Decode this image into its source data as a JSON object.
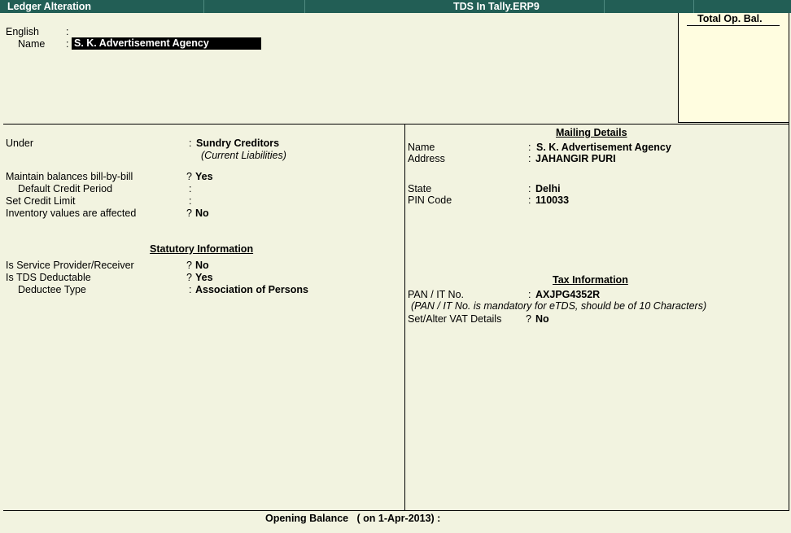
{
  "titlebar": {
    "left": "Ledger Alteration",
    "center": "TDS In Tally.ERP9"
  },
  "header": {
    "english_label": "English",
    "name_label": "Name",
    "colon": ":",
    "name_value": "S. K. Advertisement Agency",
    "total_op_bal_label": "Total Op. Bal."
  },
  "left": {
    "under_label": "Under",
    "under_value": "Sundry Creditors",
    "under_group": "(Current Liabilities)",
    "bill_by_bill_label": "Maintain balances bill-by-bill",
    "bill_by_bill_value": "Yes",
    "credit_period_label": "Default Credit Period",
    "credit_limit_label": "Set Credit Limit",
    "inventory_label": "Inventory values are affected",
    "inventory_value": "No",
    "statutory_heading": "Statutory Information",
    "service_label": "Is Service Provider/Receiver",
    "service_value": "No",
    "tds_label": "Is TDS Deductable",
    "tds_value": "Yes",
    "deductee_label": "Deductee Type",
    "deductee_value": "Association of Persons"
  },
  "right": {
    "mailing_heading": "Mailing Details",
    "name_label": "Name",
    "name_value": "S. K. Advertisement Agency",
    "address_label": "Address",
    "address_value": "JAHANGIR PURI",
    "state_label": "State",
    "state_value": "Delhi",
    "pin_label": "PIN Code",
    "pin_value": "110033",
    "tax_heading": "Tax Information",
    "pan_label": "PAN / IT No.",
    "pan_value": "AXJPG4352R",
    "pan_note": "(PAN / IT No. is mandatory for eTDS, should be of 10 Characters)",
    "vat_label": "Set/Alter VAT Details",
    "vat_value": "No"
  },
  "footer": {
    "opening_balance": "Opening Balance   ( on 1-Apr-2013) :"
  },
  "symbols": {
    "colon": ":",
    "question": "?"
  },
  "colors": {
    "titlebar": "#225e55",
    "background": "#f2f3e0",
    "opbal_box": "#fffde0"
  }
}
